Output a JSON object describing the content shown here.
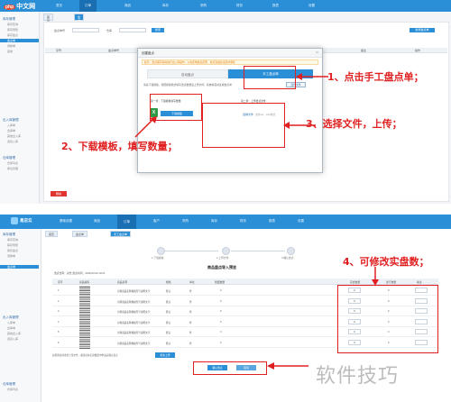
{
  "site_badge": {
    "brand_php": "php",
    "brand_cn": "中文网"
  },
  "panel1": {
    "top_nav": [
      "首页",
      "订单",
      "商品",
      "库存",
      "采购",
      "财务",
      "报表",
      "设置"
    ],
    "sidebar": {
      "groups": [
        "库存管理",
        "出入库管理",
        "仓库管理"
      ],
      "items_g1": [
        "库存查询",
        "库存预警",
        "库存盘点",
        "盘点单",
        "调拨单",
        "其他"
      ],
      "items_g2": [
        "入库单",
        "出库单",
        "其他出入库",
        "退货入库"
      ],
      "items_g3": [
        "仓库列表",
        "库位管理"
      ]
    },
    "tabs": [
      "首页",
      "盘点单"
    ],
    "filters": {
      "label1": "盘点单号",
      "label2": "仓库",
      "search": "搜索",
      "add": "新增盘点单"
    },
    "table_headers": [
      "序号",
      "盘点单号",
      "仓库",
      "盘点时间",
      "操作人",
      "状态",
      "备注",
      "操作"
    ],
    "red_button": "删除",
    "modal": {
      "title": "创建盘点",
      "close": "×",
      "warning": "提示：盘点期间请勿进行出入库操作，以免影响盘点结果，盘点完成后请及时审核",
      "tab_auto": "自动盘点",
      "tab_manual": "手工盘点单",
      "desc": "请先下载模板，按照模板格式填写盘点数量后上传文件，系统将自动生成盘点单",
      "small_btn": "选择文件",
      "step1": "第一步：下载模板填写数量",
      "step2": "第二步：上传盘点文件",
      "excel_icon_label": "X",
      "download_btn": "下载模板",
      "upload_link": "选择文件",
      "upload_hint": "支持xls、xlsx格式"
    }
  },
  "annotations": {
    "a1": "1、点击手工盘点单；",
    "a2": "2、下载模板，填写数量；",
    "a3": "3、选择文件，上传；",
    "a4": "4、可修改实盘数；"
  },
  "panel2": {
    "brand": "易店云",
    "top_nav": [
      "基础设置",
      "商品",
      "订单",
      "客户",
      "采购",
      "库存",
      "财务",
      "报表",
      "设置"
    ],
    "tabs": [
      "首页",
      "盘点单",
      "手工盘点单"
    ],
    "steps": [
      "1.下载模板",
      "2.上传文件",
      "3.确认盘点"
    ],
    "doc_title": "商品盘点导入预览",
    "meta": "盘点仓库：总仓      盘点时间：2019-03-20 10:21",
    "headers": [
      "序号",
      "商品编码",
      "商品名称",
      "规格",
      "单位",
      "账面数量",
      "实盘数量",
      "盈亏数量",
      "备注"
    ],
    "rows": [
      {
        "no": "1",
        "name": "示例商品名称规格型号说明文字",
        "spec": "默认",
        "unit": "件",
        "book": "0",
        "real": "0",
        "diff": "0"
      },
      {
        "no": "2",
        "name": "示例商品名称规格型号说明文字",
        "spec": "默认",
        "unit": "件",
        "book": "0",
        "real": "0",
        "diff": "0"
      },
      {
        "no": "3",
        "name": "示例商品名称规格型号说明文字",
        "spec": "默认",
        "unit": "件",
        "book": "0",
        "real": "0",
        "diff": "0"
      },
      {
        "no": "4",
        "name": "示例商品名称规格型号说明文字",
        "spec": "默认",
        "unit": "件",
        "book": "0",
        "real": "0",
        "diff": "0"
      },
      {
        "no": "5",
        "name": "示例商品名称规格型号说明文字",
        "spec": "默认",
        "unit": "件",
        "book": "0",
        "real": "0",
        "diff": "0"
      },
      {
        "no": "6",
        "name": "示例商品名称规格型号说明文字",
        "spec": "默认",
        "unit": "件",
        "book": "0",
        "real": "0",
        "diff": "0"
      }
    ],
    "footer_note": "如需修改请重新上传文件，或直接在实盘数量中修改后确认盘点",
    "reupload_btn": "重新上传",
    "confirm_btn": "确认盘点",
    "cancel_btn": "取消"
  },
  "watermark": "软件技巧",
  "colors": {
    "brand_blue": "#2a8fd6",
    "annotation_red": "#e02020",
    "excel_green": "#2f9a47"
  }
}
